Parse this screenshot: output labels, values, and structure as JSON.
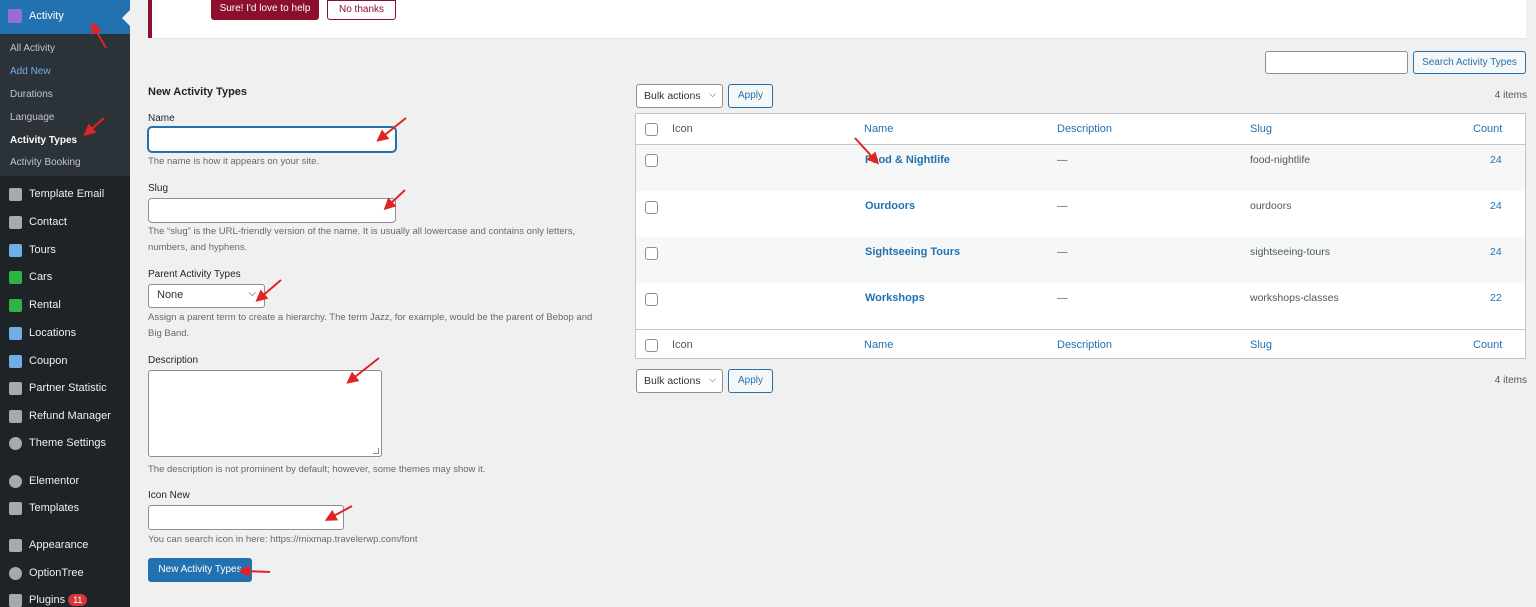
{
  "sidebar": {
    "current": {
      "label": "Activity",
      "icon": "activity-icon"
    },
    "submenu": [
      "All Activity",
      "Add New",
      "Durations",
      "Language",
      "Activity Types",
      "Activity Booking"
    ],
    "items": [
      {
        "label": "Template Email",
        "icon": "email-icon"
      },
      {
        "label": "Contact",
        "icon": "mail-icon"
      },
      {
        "label": "Tours",
        "icon": "palm-tree-icon"
      },
      {
        "label": "Cars",
        "icon": "car-icon"
      },
      {
        "label": "Rental",
        "icon": "house-icon"
      },
      {
        "label": "Locations",
        "icon": "map-icon"
      },
      {
        "label": "Coupon",
        "icon": "tag-icon"
      },
      {
        "label": "Partner Statistic",
        "icon": "user-icon"
      },
      {
        "label": "Refund Manager",
        "icon": "shuffle-icon"
      },
      {
        "label": "Theme Settings",
        "icon": "settings-icon"
      },
      {
        "label": "Elementor",
        "icon": "elementor-icon"
      },
      {
        "label": "Templates",
        "icon": "folder-icon"
      },
      {
        "label": "Appearance",
        "icon": "brush-icon"
      },
      {
        "label": "OptionTree",
        "icon": "optiontree-icon"
      },
      {
        "label": "Plugins",
        "icon": "plugin-icon",
        "badge": "11"
      }
    ]
  },
  "notice": {
    "yes_label": "Sure! I'd love to help",
    "no_label": "No thanks"
  },
  "form": {
    "heading": "New Activity Types",
    "name_label": "Name",
    "name_help": "The name is how it appears on your site.",
    "slug_label": "Slug",
    "slug_help": "The “slug” is the URL-friendly version of the name. It is usually all lowercase and contains only letters, numbers, and hyphens.",
    "parent_label": "Parent Activity Types",
    "parent_value": "None",
    "parent_help": "Assign a parent term to create a hierarchy. The term Jazz, for example, would be the parent of Bebop and Big Band.",
    "description_label": "Description",
    "description_help": "The description is not prominent by default; however, some themes may show it.",
    "icon_label": "Icon New",
    "icon_help": "You can search icon in here: https://mixmap.travelerwp.com/font",
    "submit_label": "New Activity Types"
  },
  "search": {
    "button_label": "Search Activity Types"
  },
  "bulk": {
    "select_label": "Bulk actions",
    "apply_label": "Apply",
    "items_count": "4 items"
  },
  "table": {
    "columns": {
      "icon": "Icon",
      "name": "Name",
      "description": "Description",
      "slug": "Slug",
      "count": "Count"
    },
    "rows": [
      {
        "name": "Food & Nightlife",
        "description": "—",
        "slug": "food-nightlife",
        "count": "24"
      },
      {
        "name": "Ourdoors",
        "description": "—",
        "slug": "ourdoors",
        "count": "24"
      },
      {
        "name": "Sightseeing Tours",
        "description": "—",
        "slug": "sightseeing-tours",
        "count": "24"
      },
      {
        "name": "Workshops",
        "description": "—",
        "slug": "workshops-classes",
        "count": "22"
      }
    ]
  },
  "colors": {
    "accent": "#2271b1",
    "sidebar_bg": "#1d2327",
    "notice_accent": "#8c0f2e",
    "annotation_arrow": "#e02424"
  }
}
